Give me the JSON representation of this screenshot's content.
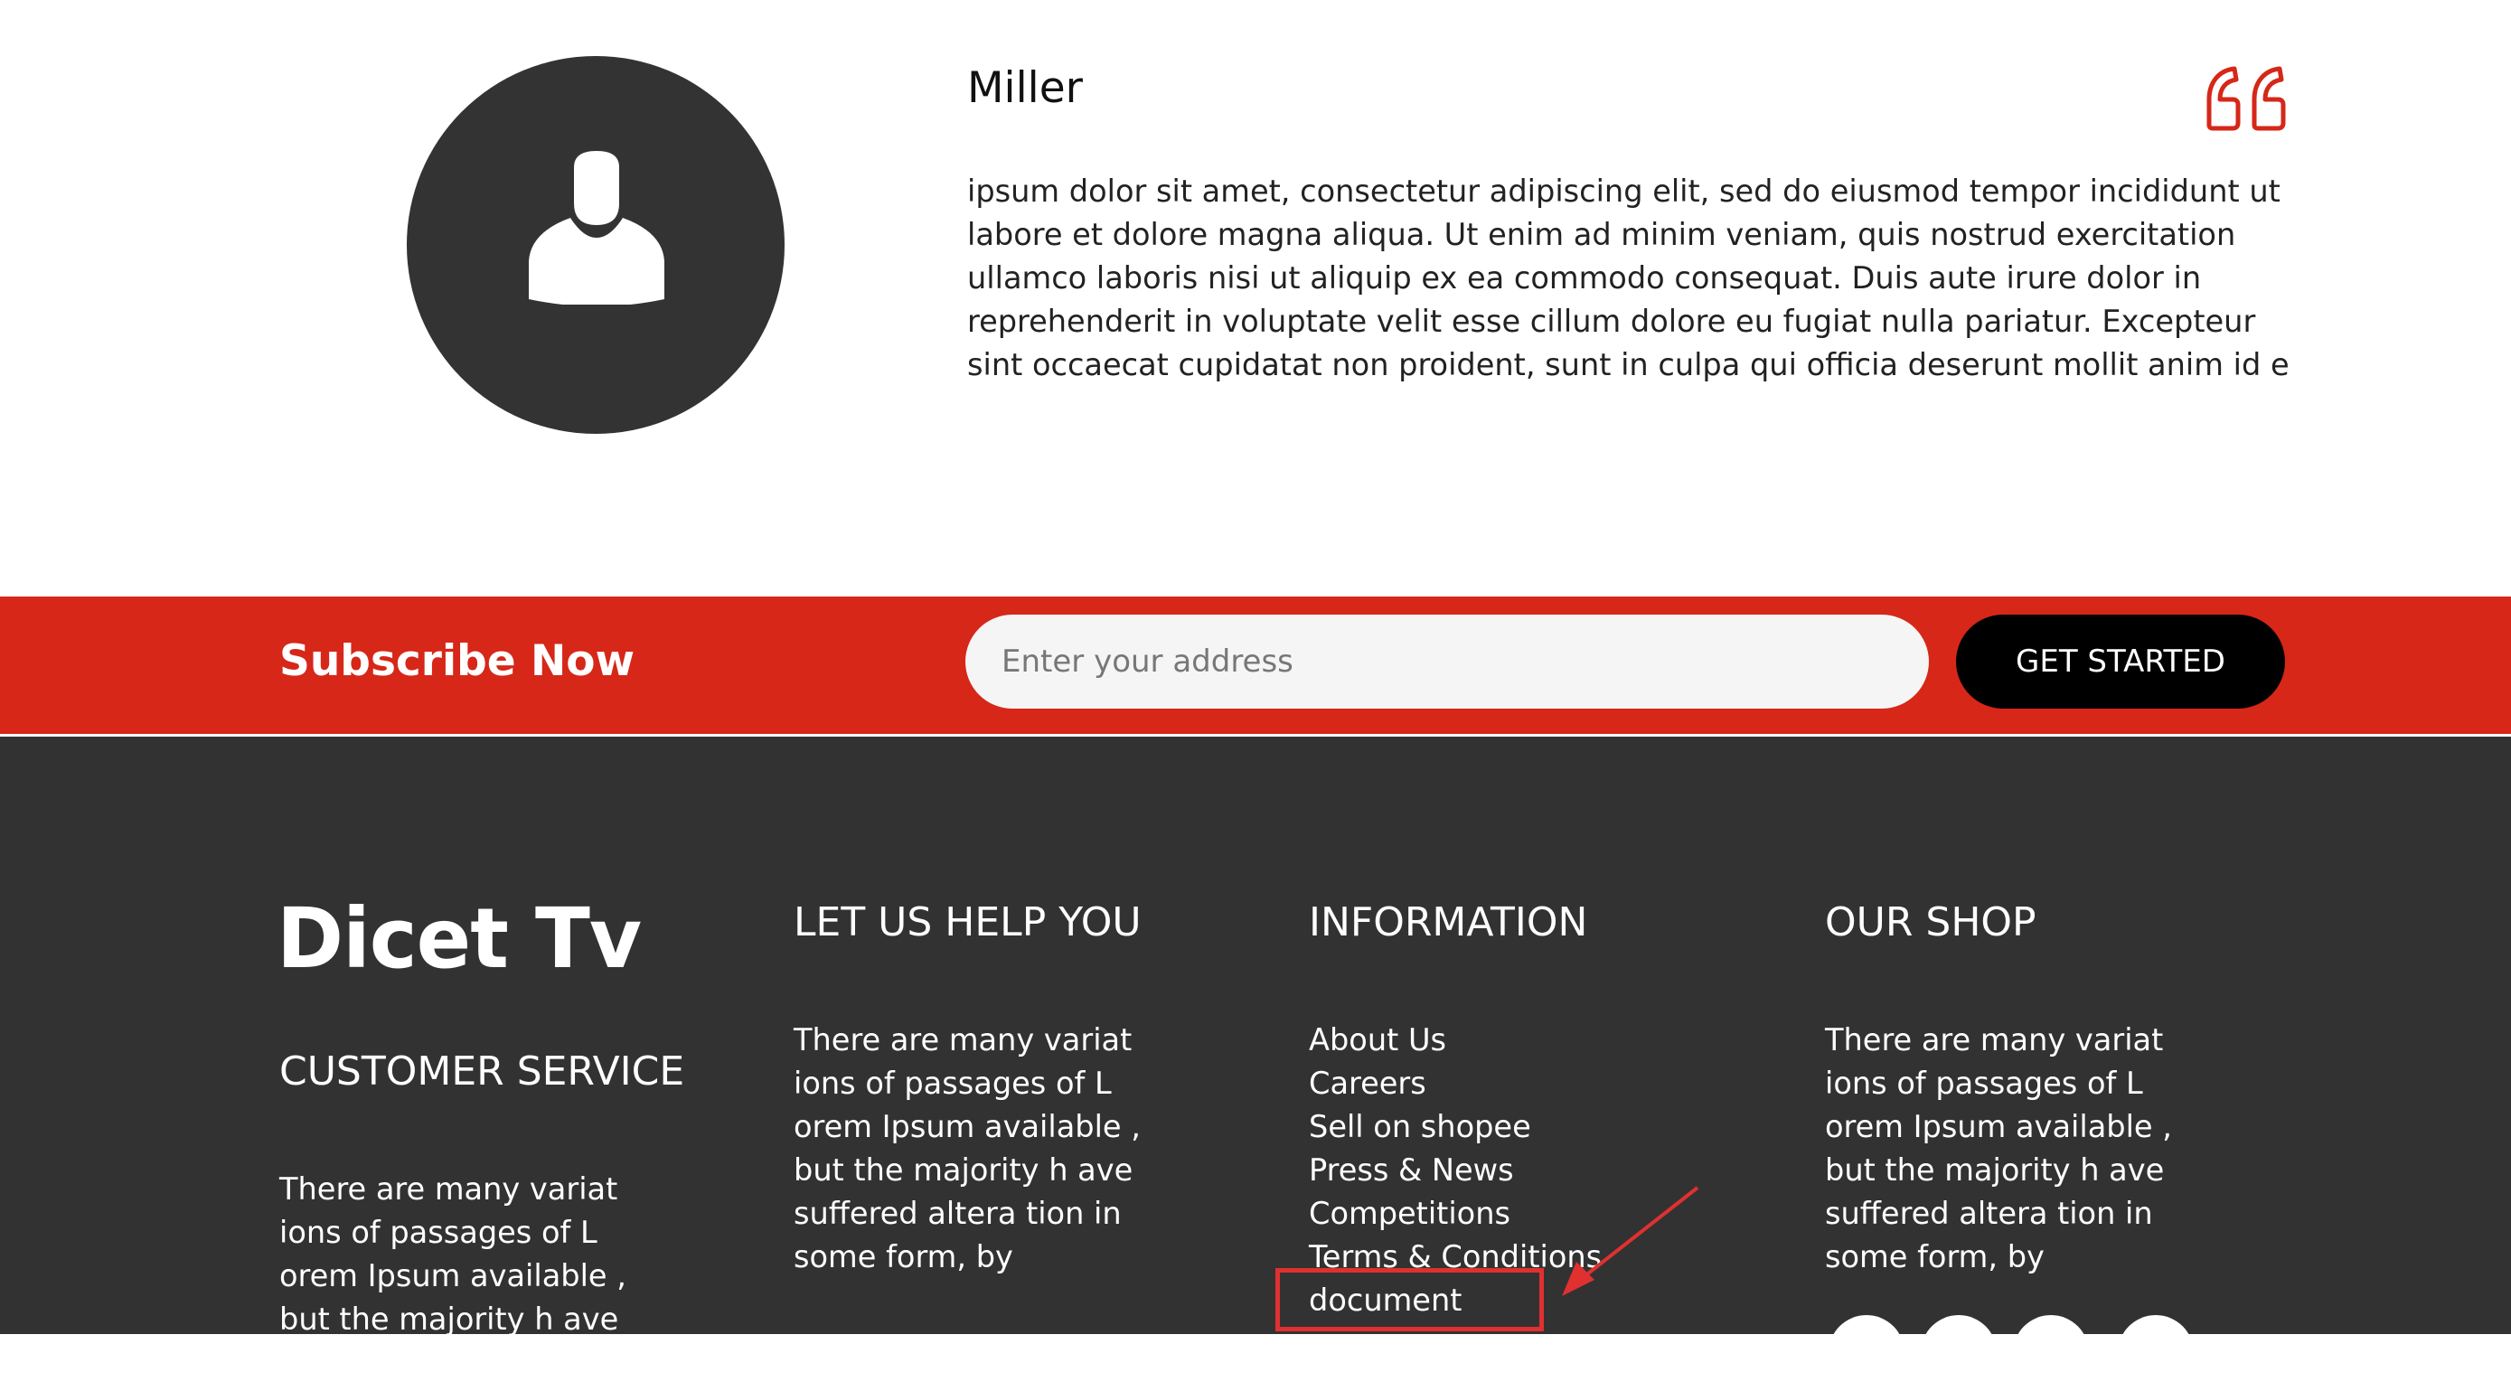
{
  "testimonial": {
    "name": "Miller",
    "text": "ipsum dolor sit amet, consectetur adipiscing elit, sed do eiusmod tempor incididunt ut labore et dolore magna aliqua. Ut enim ad minim veniam, quis nostrud exercitation ullamco laboris nisi ut aliquip ex ea commodo consequat. Duis aute irure dolor in reprehenderit in voluptate velit esse cillum dolore eu fugiat nulla pariatur. Excepteur sint occaecat cupidatat non proident, sunt in culpa qui officia deserunt mollit anim id e",
    "avatar_icon": "user-icon",
    "quote_icon": "quote-icon"
  },
  "subscribe": {
    "title": "Subscribe Now",
    "input_placeholder": "Enter your address",
    "button_label": "GET STARTED"
  },
  "footer": {
    "logo": "Dicet Tv",
    "customer_service": {
      "heading": "CUSTOMER SERVICE",
      "text": "There are many variat ions of passages of L orem Ipsum available , but the majority h ave"
    },
    "help": {
      "heading": "LET US HELP YOU",
      "text": "There are many variat ions of passages of L orem Ipsum available , but the majority h ave suffered altera tion in some form, by"
    },
    "information": {
      "heading": "INFORMATION",
      "links": [
        "About Us",
        "Careers",
        "Sell on shopee",
        "Press & News",
        "Competitions",
        "Terms & Conditions",
        "document"
      ]
    },
    "shop": {
      "heading": "OUR SHOP",
      "text": "There are many variat ions of passages of L orem Ipsum available , but the majority h ave suffered altera tion in some form, by"
    }
  },
  "colors": {
    "accent_red": "#d62718",
    "footer_bg": "#323232",
    "avatar_bg": "#333333",
    "button_bg": "#000000",
    "annotation_red": "#e03030"
  }
}
